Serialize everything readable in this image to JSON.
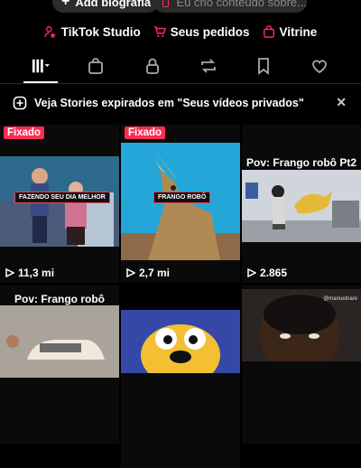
{
  "header": {
    "add_bio_label": "Add biografia",
    "about_placeholder": "Eu crio conteúdo sobre..."
  },
  "links": [
    {
      "label": "TikTok Studio",
      "icon": "person-star-icon"
    },
    {
      "label": "Seus pedidos",
      "icon": "cart-icon"
    },
    {
      "label": "Vitrine",
      "icon": "bag-icon"
    }
  ],
  "tabs": [
    "grid-icon",
    "shopping-bag-icon",
    "lock-icon",
    "repost-icon",
    "bookmark-icon",
    "heart-icon"
  ],
  "banner": {
    "text": "Veja Stories expirados em \"Seus vídeos privados\""
  },
  "videos": [
    {
      "badge": "Fixado",
      "overlay": "FAZENDO SEU DIA MELHOR",
      "views": "11,3 mi"
    },
    {
      "badge": "Fixado",
      "overlay": "FRANGO ROBÔ",
      "views": "2,7 mi"
    },
    {
      "caption": "Pov: Frango robô Pt2",
      "views": "2.865"
    },
    {
      "caption": "Pov: Frango robô"
    },
    {},
    {
      "watermark": "@manuelnare"
    }
  ],
  "colors": {
    "accent": "#fe2c55",
    "background": "#000000"
  }
}
